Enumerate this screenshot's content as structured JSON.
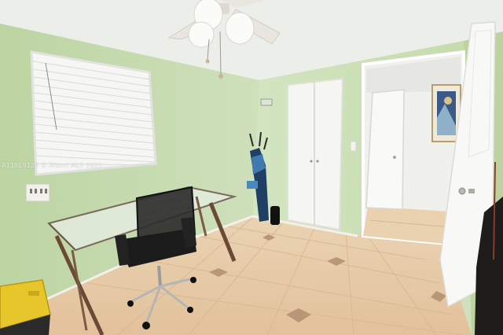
{
  "photo": {
    "watermark": "A11819120 © Miami MLS 2025"
  },
  "colors": {
    "wall": "#c9ddb3",
    "ceiling": "#eceeea",
    "floor_tile": "#e9c9a3",
    "door_white": "#f4f4f1",
    "grout": "#d5b38e"
  }
}
